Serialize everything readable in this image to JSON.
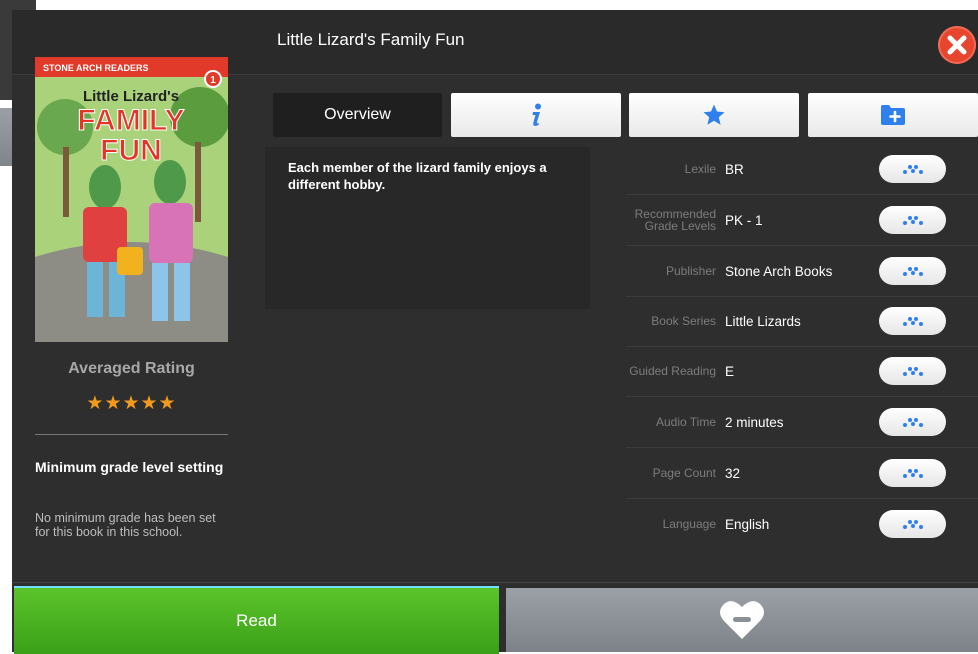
{
  "header": {
    "title": "Little Lizard's Family Fun"
  },
  "cover": {
    "series_banner": "STONE ARCH READERS",
    "level_badge": "1",
    "book_title_line1": "Little Lizard's",
    "book_title_line2": "FAMILY",
    "book_title_line3": "FUN"
  },
  "rating": {
    "title": "Averaged Rating",
    "stars": "★★★★★"
  },
  "min_grade": {
    "title": "Minimum grade level setting",
    "text": "No minimum grade has been set for this book in this school."
  },
  "tabs": {
    "overview": "Overview",
    "info_icon": "info-icon",
    "star_icon": "star-icon",
    "folder_icon": "folder-add-icon"
  },
  "description": "Each member of the lizard family enjoys a different hobby.",
  "meta": [
    {
      "label": "Lexile",
      "value": "BR"
    },
    {
      "label": "Recommended Grade Levels",
      "value": "PK - 1"
    },
    {
      "label": "Publisher",
      "value": "Stone Arch Books"
    },
    {
      "label": "Book Series",
      "value": "Little Lizards"
    },
    {
      "label": "Guided Reading",
      "value": "E"
    },
    {
      "label": "Audio Time",
      "value": "2 minutes"
    },
    {
      "label": "Page Count",
      "value": "32"
    },
    {
      "label": "Language",
      "value": "English"
    }
  ],
  "actions": {
    "read": "Read",
    "favorite_icon": "heart-minus-icon"
  },
  "colors": {
    "accent_blue": "#2f80ed",
    "read_green": "#4cb521",
    "close_red": "#e8452f",
    "star_orange": "#f39a1e"
  }
}
